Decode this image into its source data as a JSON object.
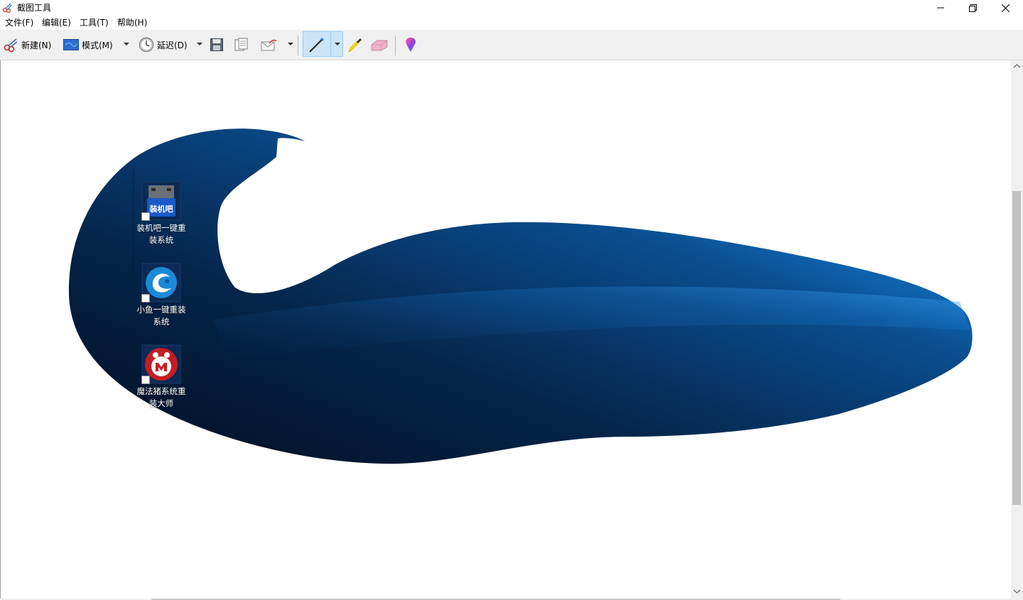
{
  "window": {
    "title": "截图工具",
    "controls": {
      "minimize": "minimize-icon",
      "maximize": "restore-icon",
      "close": "close-icon"
    }
  },
  "menu": [
    {
      "label": "文件(F)"
    },
    {
      "label": "编辑(E)"
    },
    {
      "label": "工具(T)"
    },
    {
      "label": "帮助(H)"
    }
  ],
  "toolbar": {
    "new_label": "新建(N)",
    "mode_label": "模式(M)",
    "delay_label": "延迟(D)",
    "icons": [
      "scissors-icon",
      "mode-icon",
      "clock-icon",
      "save-icon",
      "copy-icon",
      "email-icon",
      "pen-icon",
      "highlighter-icon",
      "eraser-icon",
      "paint3d-icon"
    ]
  },
  "desktop_icons": [
    {
      "label": "装机吧一键重装系统",
      "line1": "装机吧一键重",
      "line2": "装系统",
      "icon": "zhuangjiba-icon",
      "badge_text": "装机吧"
    },
    {
      "label": "小鱼一键重装系统",
      "line1": "小鱼一键重装",
      "line2": "系统",
      "icon": "xiaoyu-icon"
    },
    {
      "label": "魔法猪系统重装大师",
      "line1": "魔法猪系统重",
      "line2": "装大师",
      "icon": "mofazhu-icon"
    }
  ],
  "colors": {
    "wallpaper_dark": "#061a33",
    "wallpaper_mid": "#0a4a8a",
    "wallpaper_light": "#1a8ae0",
    "toolbar_bg": "#f0f0f0",
    "pen_active_bg": "#cce4f7"
  }
}
